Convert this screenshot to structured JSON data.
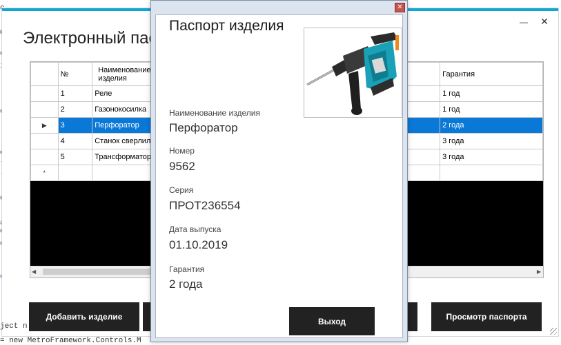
{
  "main_window": {
    "title": "Электронный пас",
    "min_symbol": "—",
    "close_symbol": "✕",
    "grid": {
      "columns": [
        "№",
        "Наименование\nизделия",
        "Гарантия"
      ],
      "rows": [
        {
          "num": "1",
          "name": "Реле",
          "warranty": "1 год"
        },
        {
          "num": "2",
          "name": "Газонокосилка",
          "warranty": "1 год"
        },
        {
          "num": "3",
          "name": "Перфоратор",
          "warranty": "2 года"
        },
        {
          "num": "4",
          "name": "Станок сверлил",
          "warranty": "3 года"
        },
        {
          "num": "5",
          "name": "Трансформатор",
          "warranty": "3 года"
        }
      ],
      "selected_row_marker": "▶",
      "new_row_marker": "*"
    },
    "buttons": {
      "add_label": "Добавить изделие",
      "view_passport_label": "Просмотр паспорта"
    }
  },
  "dialog": {
    "title": "Паспорт изделия",
    "close_symbol": "✕",
    "fields": [
      {
        "label": "Наименование изделия",
        "value": "Перфоратор"
      },
      {
        "label": "Номер",
        "value": "9562"
      },
      {
        "label": "Серия",
        "value": "ПРОТ236554"
      },
      {
        "label": "Дата выпуска",
        "value": "01.10.2019"
      },
      {
        "label": "Гарантия",
        "value": "2 года"
      }
    ],
    "exit_label": "Выход"
  },
  "code_behind": {
    "bottom_line": "= new MetroFramework.Controls.M",
    "fragment_line": "ject  new Technolog()"
  },
  "colors": {
    "accent": "#10a7d4",
    "selection": "#0a78d7",
    "button_bg": "#222222"
  }
}
